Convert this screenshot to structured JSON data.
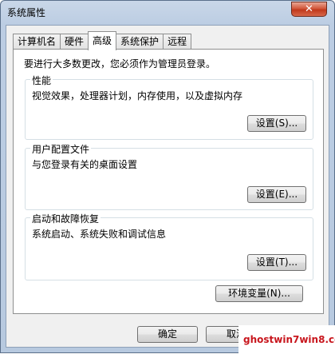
{
  "window": {
    "title": "系统属性",
    "close_glyph": "✕"
  },
  "tabs": [
    {
      "label": "计算机名",
      "active": false
    },
    {
      "label": "硬件",
      "active": false
    },
    {
      "label": "高级",
      "active": true
    },
    {
      "label": "系统保护",
      "active": false
    },
    {
      "label": "远程",
      "active": false
    }
  ],
  "notice": "要进行大多数更改，您必须作为管理员登录。",
  "groups": {
    "performance": {
      "title": "性能",
      "desc": "视觉效果，处理器计划，内存使用，以及虚拟内存",
      "button": "设置(S)..."
    },
    "profiles": {
      "title": "用户配置文件",
      "desc": "与您登录有关的桌面设置",
      "button": "设置(E)..."
    },
    "startup": {
      "title": "启动和故障恢复",
      "desc": "系统启动、系统失败和调试信息",
      "button": "设置(T)..."
    }
  },
  "env_button": "环境变量(N)...",
  "footer": {
    "ok": "确定",
    "cancel": "取消"
  },
  "watermark": "ghostwin7win8.com",
  "colors": {
    "close_button": "#c0391c",
    "watermark": "#c8161d"
  }
}
